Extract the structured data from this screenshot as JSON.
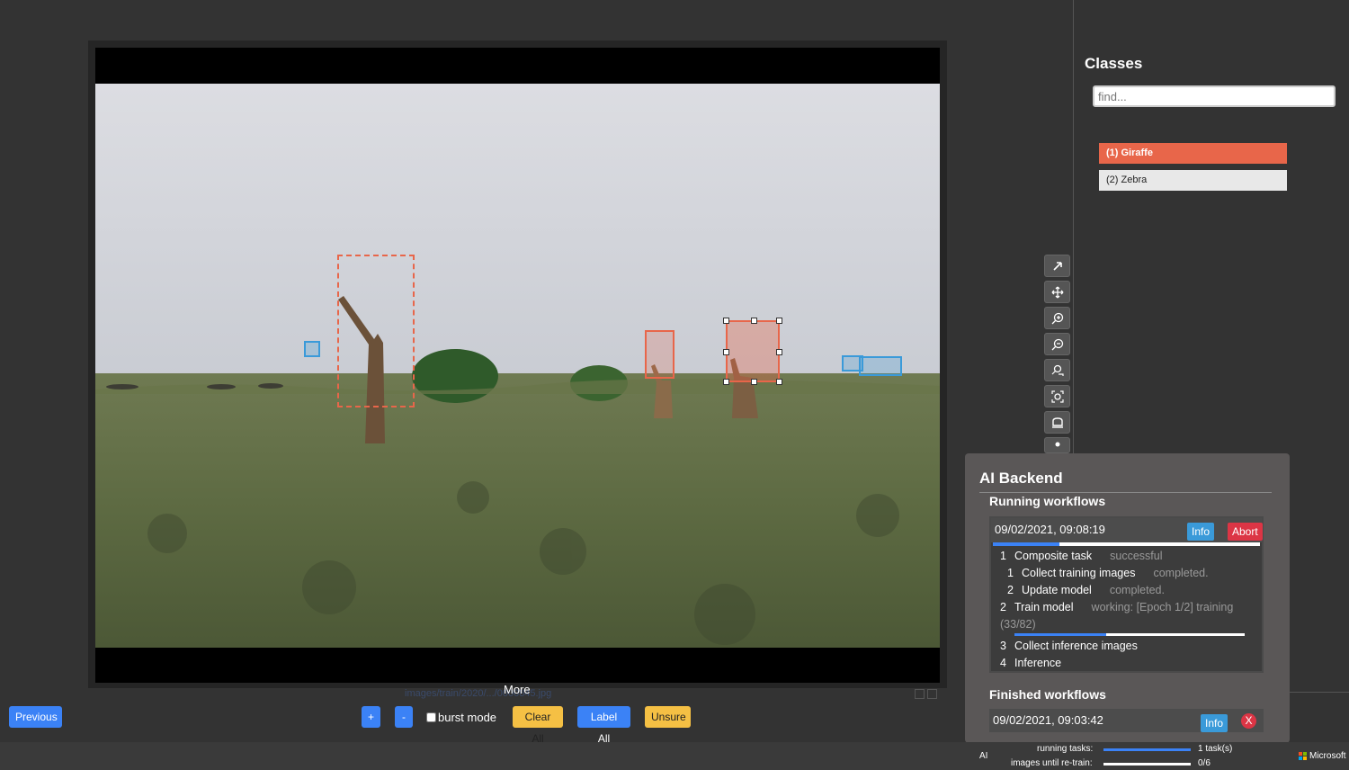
{
  "viewer": {
    "filename": "images/train/2020/.../0000845.jpg",
    "more_label": "More"
  },
  "toolbar": {
    "previous_label": "Previous",
    "plus_label": "+",
    "minus_label": "-",
    "burst_label": "burst mode",
    "burst_checked": false,
    "clear_all_label": "Clear All",
    "label_all_label": "Label All",
    "unsure_label": "Unsure"
  },
  "classes": {
    "title": "Classes",
    "search_placeholder": "find...",
    "items": [
      {
        "label": "(1) Giraffe",
        "color": "#e8664a",
        "active": true
      },
      {
        "label": "(2) Zebra",
        "color": "#3a9ad9",
        "active": false
      }
    ]
  },
  "tools": [
    "select-icon",
    "pan-icon",
    "zoom-in-icon",
    "zoom-out-icon",
    "zoom-area-icon",
    "zoom-fit-icon",
    "rectangle-icon",
    "pin-icon"
  ],
  "ai_backend": {
    "title": "AI Backend",
    "running_title": "Running workflows",
    "running": {
      "date": "09/02/2021, 09:08:19",
      "info_label": "Info",
      "abort_label": "Abort",
      "progress": 0.25,
      "tasks": [
        {
          "num": "1",
          "name": "Composite task",
          "status": "successful"
        },
        {
          "num": "1",
          "name": "Collect training images",
          "status": "completed."
        },
        {
          "num": "2",
          "name": "Update model",
          "status": "completed."
        },
        {
          "num": "2",
          "name": "Train model",
          "status": "working: [Epoch 1/2] training"
        },
        {
          "num": "3",
          "name": "Collect inference images",
          "status": ""
        },
        {
          "num": "4",
          "name": "Inference",
          "status": ""
        }
      ],
      "train_status_cont": "(33/82)",
      "train_progress": 0.4
    },
    "finished_title": "Finished workflows",
    "finished": {
      "date": "09/02/2021, 09:03:42",
      "info_label": "Info",
      "close_label": "X"
    }
  },
  "statusbar": {
    "ai_label": "AI",
    "running_tasks_label": "running tasks:",
    "running_tasks_value": "1 task(s)",
    "running_tasks_progress": 1.0,
    "retrain_label": "images until re-train:",
    "retrain_value": "0/6",
    "retrain_progress": 0.0,
    "brand": "Microsoft"
  },
  "colors": {
    "giraffe": "#e8664a",
    "zebra": "#3a9ad9",
    "primary": "#3b82f6",
    "warning": "#f5c044",
    "danger": "#dc3545"
  }
}
